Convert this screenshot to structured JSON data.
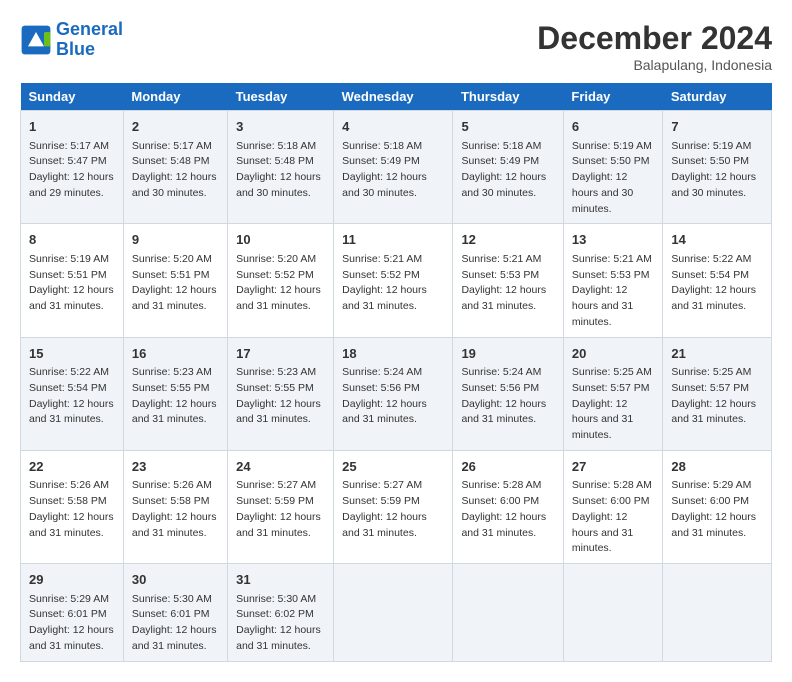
{
  "header": {
    "logo_line1": "General",
    "logo_line2": "Blue",
    "title": "December 2024",
    "subtitle": "Balapulang, Indonesia"
  },
  "weekdays": [
    "Sunday",
    "Monday",
    "Tuesday",
    "Wednesday",
    "Thursday",
    "Friday",
    "Saturday"
  ],
  "weeks": [
    [
      {
        "day": "1",
        "sunrise": "5:17 AM",
        "sunset": "5:47 PM",
        "daylight": "12 hours and 29 minutes."
      },
      {
        "day": "2",
        "sunrise": "5:17 AM",
        "sunset": "5:48 PM",
        "daylight": "12 hours and 30 minutes."
      },
      {
        "day": "3",
        "sunrise": "5:18 AM",
        "sunset": "5:48 PM",
        "daylight": "12 hours and 30 minutes."
      },
      {
        "day": "4",
        "sunrise": "5:18 AM",
        "sunset": "5:49 PM",
        "daylight": "12 hours and 30 minutes."
      },
      {
        "day": "5",
        "sunrise": "5:18 AM",
        "sunset": "5:49 PM",
        "daylight": "12 hours and 30 minutes."
      },
      {
        "day": "6",
        "sunrise": "5:19 AM",
        "sunset": "5:50 PM",
        "daylight": "12 hours and 30 minutes."
      },
      {
        "day": "7",
        "sunrise": "5:19 AM",
        "sunset": "5:50 PM",
        "daylight": "12 hours and 30 minutes."
      }
    ],
    [
      {
        "day": "8",
        "sunrise": "5:19 AM",
        "sunset": "5:51 PM",
        "daylight": "12 hours and 31 minutes."
      },
      {
        "day": "9",
        "sunrise": "5:20 AM",
        "sunset": "5:51 PM",
        "daylight": "12 hours and 31 minutes."
      },
      {
        "day": "10",
        "sunrise": "5:20 AM",
        "sunset": "5:52 PM",
        "daylight": "12 hours and 31 minutes."
      },
      {
        "day": "11",
        "sunrise": "5:21 AM",
        "sunset": "5:52 PM",
        "daylight": "12 hours and 31 minutes."
      },
      {
        "day": "12",
        "sunrise": "5:21 AM",
        "sunset": "5:53 PM",
        "daylight": "12 hours and 31 minutes."
      },
      {
        "day": "13",
        "sunrise": "5:21 AM",
        "sunset": "5:53 PM",
        "daylight": "12 hours and 31 minutes."
      },
      {
        "day": "14",
        "sunrise": "5:22 AM",
        "sunset": "5:54 PM",
        "daylight": "12 hours and 31 minutes."
      }
    ],
    [
      {
        "day": "15",
        "sunrise": "5:22 AM",
        "sunset": "5:54 PM",
        "daylight": "12 hours and 31 minutes."
      },
      {
        "day": "16",
        "sunrise": "5:23 AM",
        "sunset": "5:55 PM",
        "daylight": "12 hours and 31 minutes."
      },
      {
        "day": "17",
        "sunrise": "5:23 AM",
        "sunset": "5:55 PM",
        "daylight": "12 hours and 31 minutes."
      },
      {
        "day": "18",
        "sunrise": "5:24 AM",
        "sunset": "5:56 PM",
        "daylight": "12 hours and 31 minutes."
      },
      {
        "day": "19",
        "sunrise": "5:24 AM",
        "sunset": "5:56 PM",
        "daylight": "12 hours and 31 minutes."
      },
      {
        "day": "20",
        "sunrise": "5:25 AM",
        "sunset": "5:57 PM",
        "daylight": "12 hours and 31 minutes."
      },
      {
        "day": "21",
        "sunrise": "5:25 AM",
        "sunset": "5:57 PM",
        "daylight": "12 hours and 31 minutes."
      }
    ],
    [
      {
        "day": "22",
        "sunrise": "5:26 AM",
        "sunset": "5:58 PM",
        "daylight": "12 hours and 31 minutes."
      },
      {
        "day": "23",
        "sunrise": "5:26 AM",
        "sunset": "5:58 PM",
        "daylight": "12 hours and 31 minutes."
      },
      {
        "day": "24",
        "sunrise": "5:27 AM",
        "sunset": "5:59 PM",
        "daylight": "12 hours and 31 minutes."
      },
      {
        "day": "25",
        "sunrise": "5:27 AM",
        "sunset": "5:59 PM",
        "daylight": "12 hours and 31 minutes."
      },
      {
        "day": "26",
        "sunrise": "5:28 AM",
        "sunset": "6:00 PM",
        "daylight": "12 hours and 31 minutes."
      },
      {
        "day": "27",
        "sunrise": "5:28 AM",
        "sunset": "6:00 PM",
        "daylight": "12 hours and 31 minutes."
      },
      {
        "day": "28",
        "sunrise": "5:29 AM",
        "sunset": "6:00 PM",
        "daylight": "12 hours and 31 minutes."
      }
    ],
    [
      {
        "day": "29",
        "sunrise": "5:29 AM",
        "sunset": "6:01 PM",
        "daylight": "12 hours and 31 minutes."
      },
      {
        "day": "30",
        "sunrise": "5:30 AM",
        "sunset": "6:01 PM",
        "daylight": "12 hours and 31 minutes."
      },
      {
        "day": "31",
        "sunrise": "5:30 AM",
        "sunset": "6:02 PM",
        "daylight": "12 hours and 31 minutes."
      },
      null,
      null,
      null,
      null
    ]
  ]
}
